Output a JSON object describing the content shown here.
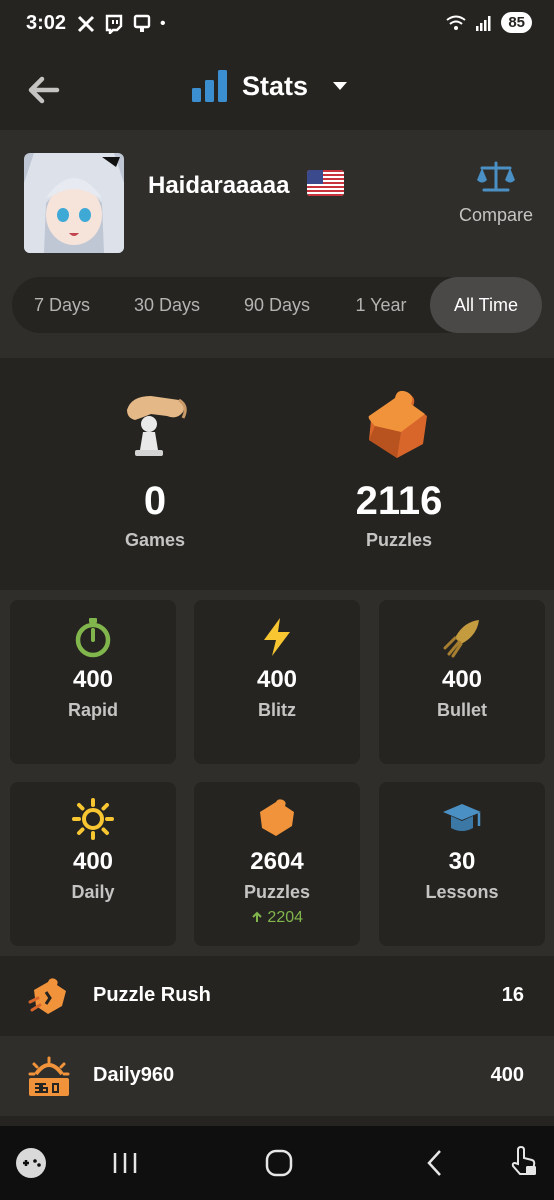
{
  "status_bar": {
    "time": "3:02",
    "dot": "•",
    "battery": "85"
  },
  "header": {
    "title": "Stats",
    "back_icon": "arrow-left-icon",
    "title_icon": "bar-chart-icon",
    "dropdown_icon": "caret-down-icon"
  },
  "profile": {
    "username": "Haidaraaaaa",
    "flag": "us-flag",
    "compare_label": "Compare"
  },
  "time_ranges": {
    "items": [
      "7 Days",
      "30 Days",
      "90 Days",
      "1 Year",
      "All Time"
    ],
    "active": "All Time"
  },
  "overview": {
    "games": {
      "value": "0",
      "label": "Games"
    },
    "puzzles": {
      "value": "2116",
      "label": "Puzzles"
    }
  },
  "cards": [
    {
      "value": "400",
      "label": "Rapid",
      "icon": "stopwatch-icon"
    },
    {
      "value": "400",
      "label": "Blitz",
      "icon": "lightning-icon"
    },
    {
      "value": "400",
      "label": "Bullet",
      "icon": "rocket-icon"
    },
    {
      "value": "400",
      "label": "Daily",
      "icon": "sun-icon"
    },
    {
      "value": "2604",
      "label": "Puzzles",
      "icon": "puzzle-icon",
      "delta": "2204"
    },
    {
      "value": "30",
      "label": "Lessons",
      "icon": "graduation-cap-icon"
    }
  ],
  "rows": [
    {
      "label": "Puzzle Rush",
      "value": "16",
      "icon": "puzzle-rush-icon"
    },
    {
      "label": "Daily960",
      "value": "400",
      "icon": "daily960-icon"
    }
  ],
  "colors": {
    "background": "#262421",
    "panel": "#302e2b",
    "green": "#81b64c",
    "orange": "#f1933b",
    "blue": "#4a90c4",
    "yellow": "#f7c631"
  }
}
